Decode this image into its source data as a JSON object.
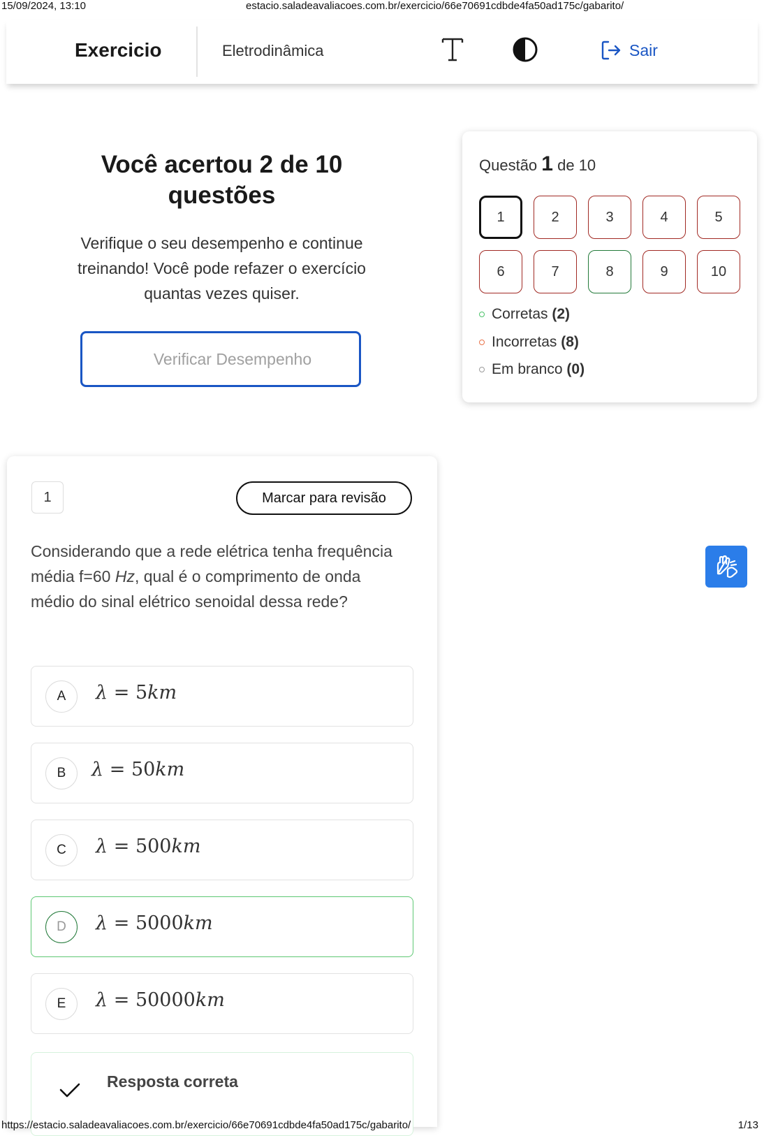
{
  "print_header": {
    "datetime": "15/09/2024, 13:10",
    "page_url": "estacio.saladeavaliacoes.com.br/exercicio/66e70691cdbde4fa50ad175c/gabarito/"
  },
  "print_footer": {
    "url": "https://estacio.saladeavaliacoes.com.br/exercicio/66e70691cdbde4fa50ad175c/gabarito/",
    "page": "1/13"
  },
  "header": {
    "title": "Exercicio",
    "subject": "Eletrodinâmica",
    "logout_label": "Sair",
    "icons": [
      "font-size-icon",
      "contrast-icon",
      "logout-icon"
    ]
  },
  "result": {
    "title": "Você acertou 2 de 10 questões",
    "message": "Verifique o seu desempenho e continue treinando! Você pode refazer o exercício quantas vezes quiser.",
    "button_label": "Verificar Desempenho"
  },
  "navigator": {
    "prefix": "Questão",
    "current": "1",
    "suffix": "de 10",
    "questions": [
      {
        "label": "1",
        "status": "current"
      },
      {
        "label": "2",
        "status": "incorrect"
      },
      {
        "label": "3",
        "status": "incorrect"
      },
      {
        "label": "4",
        "status": "incorrect"
      },
      {
        "label": "5",
        "status": "incorrect"
      },
      {
        "label": "6",
        "status": "incorrect"
      },
      {
        "label": "7",
        "status": "incorrect"
      },
      {
        "label": "8",
        "status": "correct"
      },
      {
        "label": "9",
        "status": "incorrect"
      },
      {
        "label": "10",
        "status": "incorrect"
      }
    ],
    "legend": [
      {
        "label": "Corretas",
        "count": "(2)",
        "color": "#4cc36a"
      },
      {
        "label": "Incorretas",
        "count": "(8)",
        "color": "#e8734a"
      },
      {
        "label": "Em branco",
        "count": "(0)",
        "color": "#9a9a9a"
      }
    ]
  },
  "question": {
    "number": "1",
    "review_label": "Marcar para revisão",
    "text_before": "Considerando que a rede elétrica tenha frequência média f=60 ",
    "text_unit": "Hz",
    "text_after": ", qual é o comprimento de onda médio do sinal elétrico senoidal dessa rede?",
    "options": [
      {
        "letter": "A",
        "value": "5"
      },
      {
        "letter": "B",
        "value": "50"
      },
      {
        "letter": "C",
        "value": "500"
      },
      {
        "letter": "D",
        "value": "5000",
        "correct": true
      },
      {
        "letter": "E",
        "value": "50000"
      }
    ],
    "option_symbol": "λ",
    "option_equals": "=",
    "option_unit": "km",
    "answer_label": "Resposta correta"
  },
  "colors": {
    "accent": "#1a56c4",
    "correct_border": "#237a3a",
    "incorrect_border": "#a12a24",
    "accessibility_button": "#2b7de9"
  }
}
